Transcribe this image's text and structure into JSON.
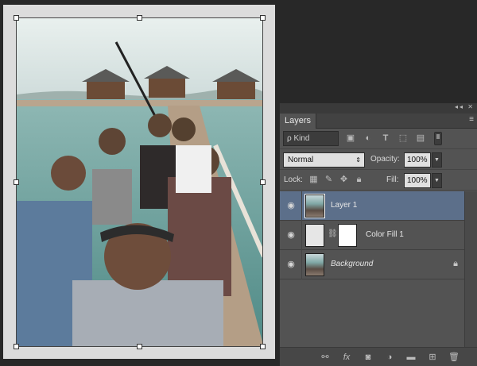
{
  "panel": {
    "tab": "Layers",
    "strip_icons": "◂◂ ✕",
    "menu_icon": "≡"
  },
  "filter": {
    "kind_label": "ρ Kind",
    "icons": [
      "image-filter-icon",
      "adjustment-filter-icon",
      "type-filter-icon",
      "shape-filter-icon",
      "smart-object-filter-icon"
    ]
  },
  "blend": {
    "mode": "Normal",
    "opacity_label": "Opacity:",
    "opacity": "100%"
  },
  "lock": {
    "label": "Lock:",
    "fill_label": "Fill:",
    "fill": "100%"
  },
  "layers": [
    {
      "name": "Layer 1",
      "selected": true
    },
    {
      "name": "Color Fill 1",
      "selected": false
    },
    {
      "name": "Background",
      "selected": false
    }
  ],
  "bottom_icons": [
    "link-layers-icon",
    "fx-icon",
    "add-mask-icon",
    "adjustment-layer-icon",
    "new-group-icon",
    "new-layer-icon",
    "trash-icon"
  ]
}
